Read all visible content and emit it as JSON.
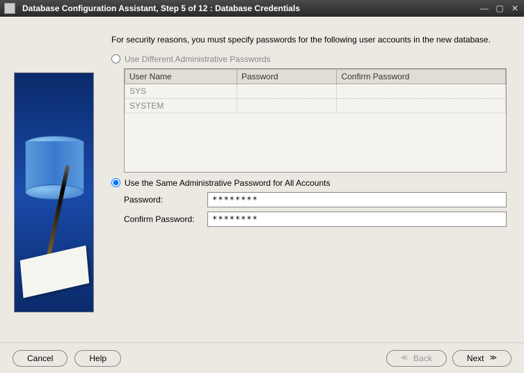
{
  "titlebar": {
    "title": "Database Configuration Assistant, Step 5 of 12 : Database Credentials"
  },
  "intro": "For security reasons, you must specify passwords for the following user accounts in the new database.",
  "option_diff": {
    "label": "Use Different Administrative Passwords",
    "selected": false
  },
  "table": {
    "headers": [
      "User Name",
      "Password",
      "Confirm Password"
    ],
    "rows": [
      {
        "user": "SYS",
        "password": "",
        "confirm": ""
      },
      {
        "user": "SYSTEM",
        "password": "",
        "confirm": ""
      }
    ]
  },
  "option_same": {
    "label": "Use the Same Administrative Password for All Accounts",
    "selected": true
  },
  "form": {
    "password_label": "Password:",
    "password_value": "********",
    "confirm_label": "Confirm Password:",
    "confirm_value": "********"
  },
  "buttons": {
    "cancel": "Cancel",
    "help": "Help",
    "back": "Back",
    "next": "Next"
  }
}
